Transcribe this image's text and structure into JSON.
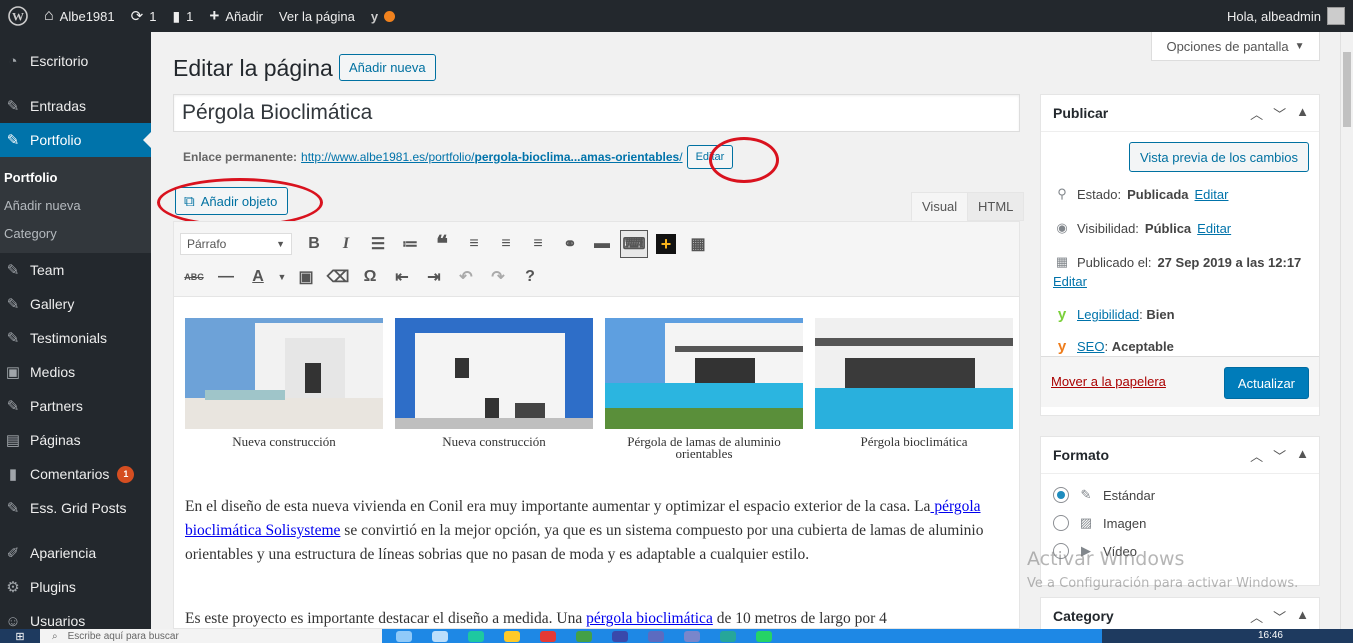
{
  "adminbar": {
    "site_name": "Albe1981",
    "updates_count": "1",
    "comments_count": "1",
    "new_label": "Añadir",
    "view_page_label": "Ver la página",
    "greeting": "Hola, albeadmin"
  },
  "sidebar": {
    "items": [
      {
        "label": "Escritorio",
        "icon": "dashboard-icon"
      },
      {
        "label": "Entradas",
        "icon": "pin-icon"
      },
      {
        "label": "Portfolio",
        "icon": "pin-icon"
      },
      {
        "label": "Team",
        "icon": "pin-icon"
      },
      {
        "label": "Gallery",
        "icon": "pin-icon"
      },
      {
        "label": "Testimonials",
        "icon": "pin-icon"
      },
      {
        "label": "Medios",
        "icon": "media-icon"
      },
      {
        "label": "Partners",
        "icon": "pin-icon"
      },
      {
        "label": "Páginas",
        "icon": "pages-icon"
      },
      {
        "label": "Comentarios",
        "icon": "comments-icon",
        "badge": "1"
      },
      {
        "label": "Ess. Grid Posts",
        "icon": "pin-icon"
      },
      {
        "label": "Apariencia",
        "icon": "appearance-icon"
      },
      {
        "label": "Plugins",
        "icon": "plugins-icon"
      },
      {
        "label": "Usuarios",
        "icon": "users-icon"
      }
    ],
    "submenu": [
      "Portfolio",
      "Añadir nueva",
      "Category"
    ]
  },
  "screen_options_label": "Opciones de pantalla",
  "heading": "Editar la página",
  "add_new_label": "Añadir nueva",
  "post_title": "Pérgola Bioclimática",
  "permalink": {
    "label": "Enlace permanente:",
    "url_base": "http://www.albe1981.es/portfolio/",
    "url_slug": "pergola-bioclima...amas-orientables",
    "url_tail": "/",
    "edit_label": "Editar"
  },
  "add_media_label": "Añadir objeto",
  "tabs": {
    "visual": "Visual",
    "html": "HTML"
  },
  "toolbar": {
    "format_value": "Párrafo"
  },
  "gallery": [
    {
      "caption": "Nueva construcción"
    },
    {
      "caption": "Nueva construcción"
    },
    {
      "caption": "Pérgola de lamas de aluminio orientables"
    },
    {
      "caption": "Pérgola bioclimática"
    }
  ],
  "content": {
    "p1_before": "En el diseño de esta nueva vivienda en Conil era muy importante aumentar y optimizar el espacio exterior de la casa. La",
    "p1_link": " pérgola bioclimática Solisysteme",
    "p1_after": " se convirtió en la mejor opción, ya que es un sistema compuesto por una cubierta de lamas de aluminio orientables y una estructura de líneas sobrias que no pasan de moda y es adaptable a cualquier estilo.",
    "p2_before": "Es este proyecto es importante destacar el diseño a medida. Una ",
    "p2_link": "pérgola bioclimática",
    "p2_after": " de 10 metros de largo por 4"
  },
  "publish": {
    "title": "Publicar",
    "preview_label": "Vista previa de los cambios",
    "status_label": "Estado:",
    "status_value": "Publicada",
    "visibility_label": "Visibilidad:",
    "visibility_value": "Pública",
    "published_label": "Publicado el:",
    "published_value": "27 Sep 2019 a las 12:17",
    "edit_label": "Editar",
    "readability_label": "Legibilidad",
    "readability_value": "Bien",
    "seo_label": "SEO",
    "seo_value": "Aceptable",
    "trash_label": "Mover a la papelera",
    "update_label": "Actualizar"
  },
  "format_box": {
    "title": "Formato",
    "options": [
      "Estándar",
      "Imagen",
      "Vídeo"
    ],
    "selected": "Estándar"
  },
  "category_box": {
    "title": "Category"
  },
  "watermark": {
    "line1": "Activar Windows",
    "line2": "Ve a Configuración para activar Windows."
  },
  "taskbar": {
    "search_placeholder": "Escribe aquí para buscar",
    "time": "16:46"
  },
  "colors": {
    "wp_blue": "#0073aa",
    "admin_dark": "#23282d",
    "highlight_red": "#d9121e",
    "update_blue": "#007cba"
  }
}
